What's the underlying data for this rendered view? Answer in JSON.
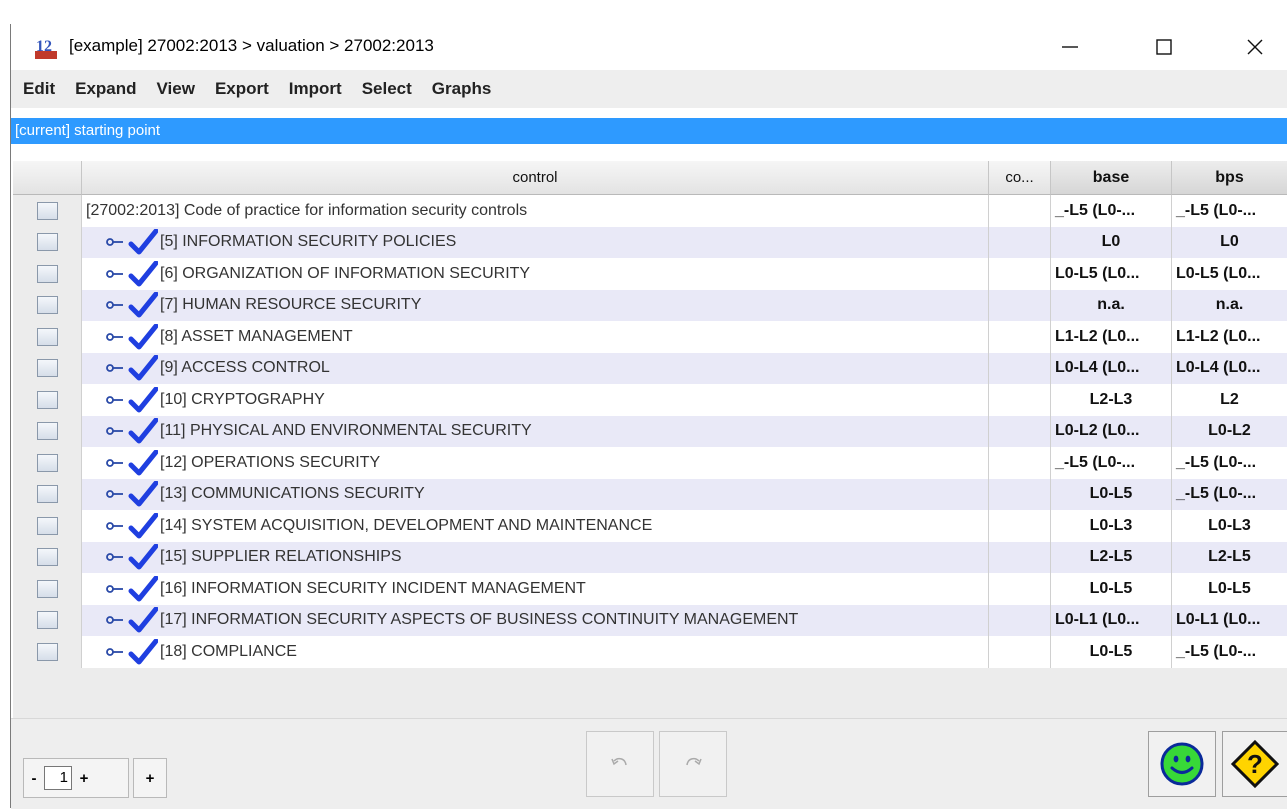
{
  "window": {
    "title": "[example] 27002:2013 > valuation > 27002:2013"
  },
  "menu": [
    "Edit",
    "Expand",
    "View",
    "Export",
    "Import",
    "Select",
    "Graphs"
  ],
  "current_label": "[current] starting point",
  "table": {
    "columns": [
      "control",
      "co...",
      "base",
      "bps"
    ],
    "rows": [
      {
        "label": "[27002:2013] Code of practice for information security controls",
        "co": "",
        "base": "_-L5 (L0-...",
        "bps": "_-L5 (L0-..."
      },
      {
        "label": "[5] INFORMATION SECURITY POLICIES",
        "co": "",
        "base": "L0",
        "bps": "L0"
      },
      {
        "label": "[6] ORGANIZATION OF INFORMATION SECURITY",
        "co": "",
        "base": "L0-L5 (L0...",
        "bps": "L0-L5 (L0..."
      },
      {
        "label": "[7] HUMAN RESOURCE SECURITY",
        "co": "",
        "base": "n.a.",
        "bps": "n.a."
      },
      {
        "label": "[8] ASSET MANAGEMENT",
        "co": "",
        "base": "L1-L2 (L0...",
        "bps": "L1-L2 (L0..."
      },
      {
        "label": "[9] ACCESS CONTROL",
        "co": "",
        "base": "L0-L4 (L0...",
        "bps": "L0-L4 (L0..."
      },
      {
        "label": "[10] CRYPTOGRAPHY",
        "co": "",
        "base": "L2-L3",
        "bps": "L2"
      },
      {
        "label": "[11] PHYSICAL AND ENVIRONMENTAL SECURITY",
        "co": "",
        "base": "L0-L2 (L0...",
        "bps": "L0-L2"
      },
      {
        "label": "[12] OPERATIONS SECURITY",
        "co": "",
        "base": "_-L5 (L0-...",
        "bps": "_-L5 (L0-..."
      },
      {
        "label": "[13] COMMUNICATIONS SECURITY",
        "co": "",
        "base": "L0-L5",
        "bps": "_-L5 (L0-..."
      },
      {
        "label": "[14] SYSTEM ACQUISITION, DEVELOPMENT AND MAINTENANCE",
        "co": "",
        "base": "L0-L3",
        "bps": "L0-L3"
      },
      {
        "label": "[15] SUPPLIER RELATIONSHIPS",
        "co": "",
        "base": "L2-L5",
        "bps": "L2-L5"
      },
      {
        "label": "[16] INFORMATION SECURITY INCIDENT MANAGEMENT",
        "co": "",
        "base": "L0-L5",
        "bps": "L0-L5"
      },
      {
        "label": "[17] INFORMATION SECURITY ASPECTS OF BUSINESS CONTINUITY MANAGEMENT",
        "co": "",
        "base": "L0-L1 (L0...",
        "bps": "L0-L1 (L0..."
      },
      {
        "label": "[18] COMPLIANCE",
        "co": "",
        "base": "L0-L5",
        "bps": "_-L5 (L0-..."
      }
    ]
  },
  "pager": {
    "minus": "-",
    "page": "1",
    "plus": "+",
    "add": "+"
  },
  "colors": {
    "accent": "#2e9aff",
    "check": "#1f3fe0",
    "smiley": "#38d838",
    "help": "#ffd400"
  },
  "icons": [
    "app-icon",
    "minimize-icon",
    "maximize-icon",
    "close-icon",
    "key-icon",
    "check-icon",
    "undo-icon",
    "redo-icon",
    "smiley-icon",
    "help-icon"
  ]
}
